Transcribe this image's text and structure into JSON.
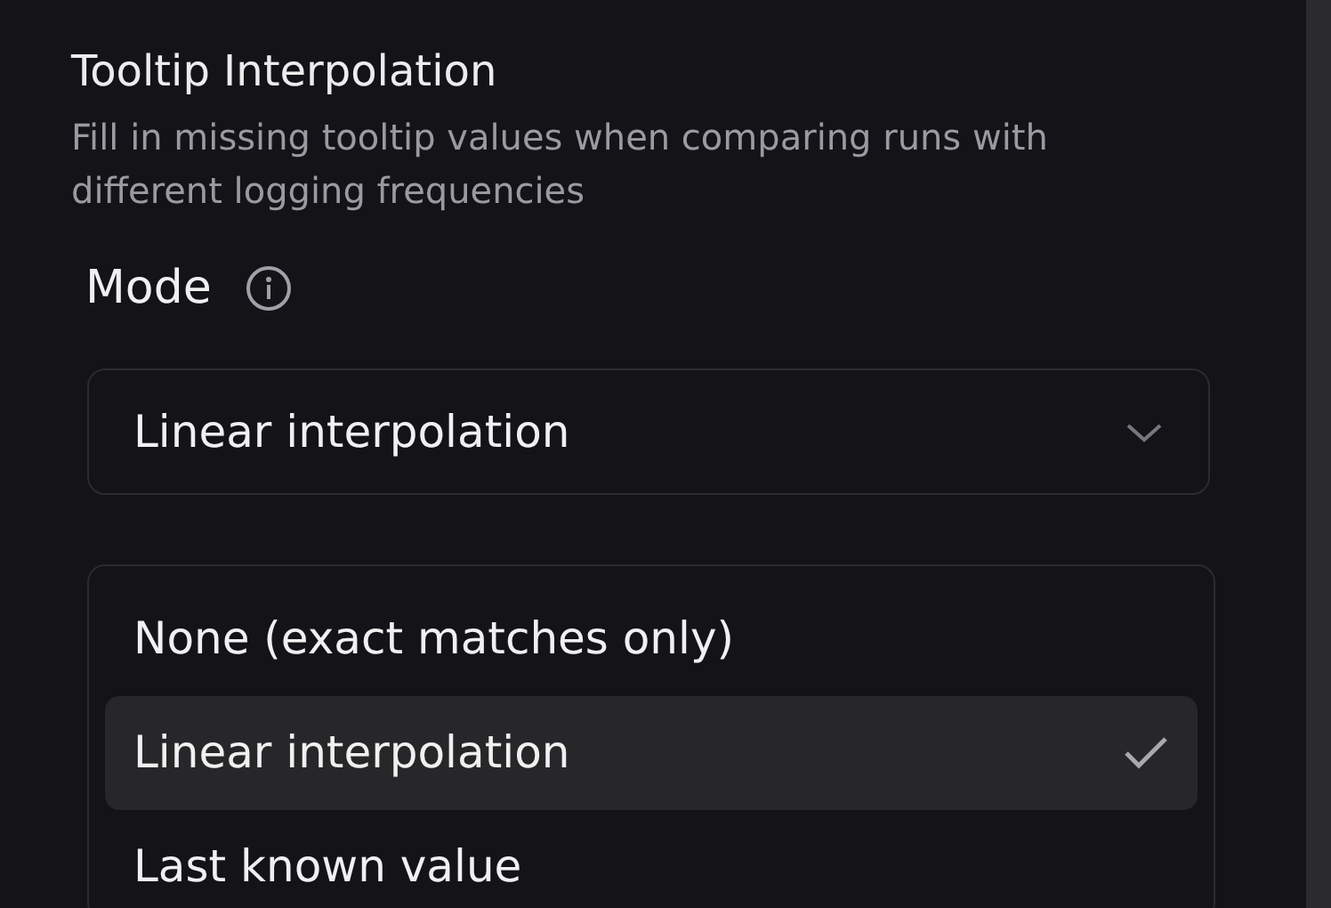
{
  "section": {
    "title": "Tooltip Interpolation",
    "description": "Fill in missing tooltip values when comparing runs with different logging frequencies"
  },
  "mode_field": {
    "label": "Mode",
    "value": "Linear interpolation"
  },
  "dropdown_menu": {
    "options": [
      {
        "label": "None (exact matches only)",
        "selected": false
      },
      {
        "label": "Linear interpolation",
        "selected": true
      },
      {
        "label": "Last known value",
        "selected": false
      }
    ]
  }
}
